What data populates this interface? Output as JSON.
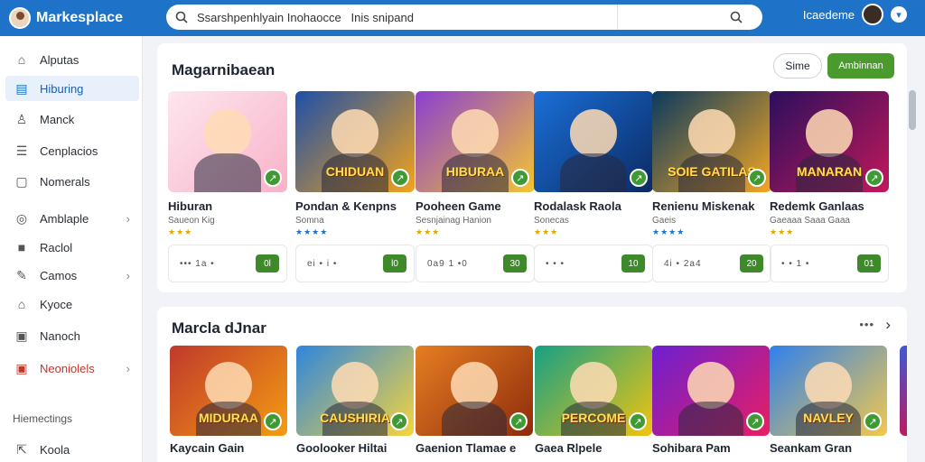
{
  "header": {
    "app_title": "Markesplace",
    "search_value": "Ssarshpenhlyain Inohaocce   Inis snipand",
    "search_placeholder": "",
    "user_name": "Icaedeme"
  },
  "sidebar": {
    "items": [
      {
        "label": "Alputas",
        "icon": "home-icon",
        "glyph": "⌂"
      },
      {
        "label": "Hiburing",
        "icon": "list-icon",
        "glyph": "▤",
        "active": true
      },
      {
        "label": "Manck",
        "icon": "person-icon",
        "glyph": "♙"
      },
      {
        "label": "Cenplacios",
        "icon": "document-icon",
        "glyph": "☰"
      },
      {
        "label": "Nomerals",
        "icon": "file-icon",
        "glyph": "▢"
      },
      {
        "label": "Amblaple",
        "icon": "target-icon",
        "glyph": "◎",
        "chevron": true
      },
      {
        "label": "Raclol",
        "icon": "bag-icon",
        "glyph": "■"
      },
      {
        "label": "Camos",
        "icon": "edit-icon",
        "glyph": "✎",
        "chevron": true
      },
      {
        "label": "Kyoce",
        "icon": "gift-icon",
        "glyph": "⌂"
      },
      {
        "label": "Nanoch",
        "icon": "note-icon",
        "glyph": "▣"
      },
      {
        "label": "Neoniolels",
        "icon": "alert-icon",
        "glyph": "▣",
        "chevron": true,
        "red": true
      }
    ],
    "section_heading": "Hiemectings",
    "bottom_item": {
      "label": "Koola",
      "icon": "share-icon",
      "glyph": "⇱"
    }
  },
  "section1": {
    "title": "Magarnibaean",
    "outline_button": "Sime",
    "green_button": "Ambinnan",
    "cards": [
      {
        "thumb_text": "",
        "title": "Hiburan",
        "sub": "Saueon  Kig",
        "stars": "★★★",
        "star_color": "#e0a800",
        "meta": "•••   1a   •",
        "btn": "0l",
        "bg": "linear-gradient(135deg,#fde6ef,#f9b2c8)"
      },
      {
        "thumb_text": "CHIDUAN",
        "title": "Pondan & Kenpns",
        "sub": "Somna",
        "stars": "★★★★",
        "star_color": "#1e73c8",
        "meta": "ei  •  i  •",
        "btn": "l0",
        "bg": "linear-gradient(135deg,#1e4fa8,#f2a31b)"
      },
      {
        "thumb_text": "HIBURAA",
        "title": "Pooheen Game",
        "sub": "Sesnjainag Hanion",
        "stars": "★★★",
        "star_color": "#e0a800",
        "meta": "0a9  1  •0",
        "btn": "30",
        "bg": "linear-gradient(135deg,#8a3fd1,#f5c530)"
      },
      {
        "thumb_text": "",
        "title": "Rodalask Raola",
        "sub": "Sonecas",
        "stars": "★★★",
        "star_color": "#e0a800",
        "meta": "•  •  •",
        "btn": "10",
        "bg": "linear-gradient(135deg,#1a6fd8,#0b2a63)"
      },
      {
        "thumb_text": "SOIE GATILAS",
        "title": "Renienu Miskenak",
        "sub": "Gaeis",
        "stars": "★★★★",
        "star_color": "#1e73c8",
        "meta": "4i  •  2a4",
        "btn": "20",
        "bg": "linear-gradient(135deg,#0a3a5f,#f5a623)"
      },
      {
        "thumb_text": "MANARAN",
        "title": "Redemk Ganlaas",
        "sub": "Gaeaaa Saaa Gaaa",
        "stars": "★★★",
        "star_color": "#e0a800",
        "meta": "•  •  1  •",
        "btn": "01",
        "bg": "linear-gradient(135deg,#2a0f5c,#c2185b)"
      }
    ]
  },
  "section2": {
    "title": "Marcla dJnar",
    "more_label": "•••",
    "next_label": "›",
    "cards": [
      {
        "thumb_text": "MIDURAA",
        "title": "Kaycain Gain",
        "bg": "linear-gradient(135deg,#c0392b,#f39c12)"
      },
      {
        "thumb_text": "CAUSHIRIA",
        "title": "Goolooker Hiltai",
        "bg": "linear-gradient(135deg,#2e86de,#f6d43c)"
      },
      {
        "thumb_text": "",
        "title": "Gaenion Tlamae e",
        "bg": "linear-gradient(135deg,#e67e22,#8e2b0b)"
      },
      {
        "thumb_text": "PERCOME",
        "title": "Gaea Rlpele",
        "bg": "linear-gradient(135deg,#16a085,#f1c40f)"
      },
      {
        "thumb_text": "",
        "title": "Sohibara Pam",
        "bg": "linear-gradient(135deg,#6c1fd1,#e91e63)"
      },
      {
        "thumb_text": "NAVLEY",
        "title": "Seankam Gran",
        "bg": "linear-gradient(135deg,#2f80ed,#f2c94c)"
      }
    ]
  }
}
